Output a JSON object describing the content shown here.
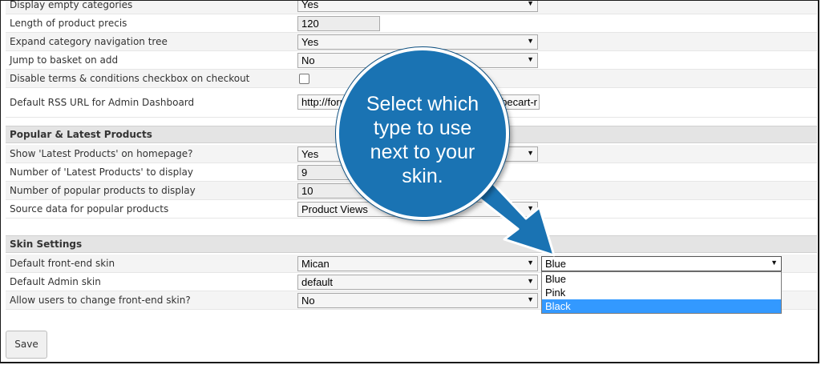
{
  "settings": {
    "display_empty_categories": {
      "label": "Display empty categories",
      "value": "Yes"
    },
    "length_product_precis": {
      "label": "Length of product precis",
      "value": "120"
    },
    "expand_category_tree": {
      "label": "Expand category navigation tree",
      "value": "Yes"
    },
    "jump_to_basket": {
      "label": "Jump to basket on add",
      "value": "No"
    },
    "disable_terms_checkbox": {
      "label": "Disable terms & conditions checkbox on checkout",
      "checked": false
    },
    "default_rss_url": {
      "label": "Default RSS URL for Admin Dashboard",
      "value_left": "http://foru",
      "value_right": "becart-r"
    }
  },
  "popular_latest": {
    "title": "Popular & Latest Products",
    "show_latest": {
      "label": "Show 'Latest Products' on homepage?",
      "value": "Yes"
    },
    "num_latest": {
      "label": "Number of 'Latest Products' to display",
      "value": "9"
    },
    "num_popular": {
      "label": "Number of popular products to display",
      "value": "10"
    },
    "source_popular": {
      "label": "Source data for popular products",
      "value": "Product Views"
    }
  },
  "skin": {
    "title": "Skin Settings",
    "frontend_skin": {
      "label": "Default front-end skin",
      "value": "Mican",
      "style_value": "Blue"
    },
    "admin_skin": {
      "label": "Default Admin skin",
      "value": "default"
    },
    "allow_change": {
      "label": "Allow users to change front-end skin?",
      "value": "No"
    }
  },
  "style_dropdown": {
    "options": [
      "Blue",
      "Pink",
      "Black"
    ],
    "highlighted": "Black"
  },
  "save_label": "Save",
  "callout": {
    "text": "Select which type to use next to your skin.",
    "color": "#1a73b3"
  }
}
